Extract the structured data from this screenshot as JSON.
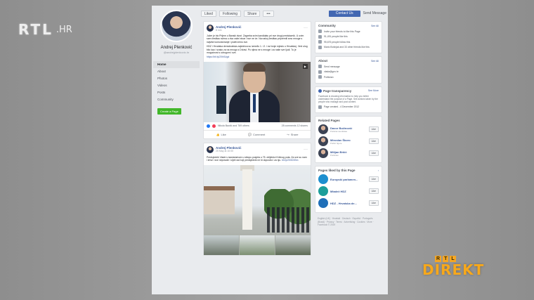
{
  "overlay": {
    "rtl_word": "RTL",
    "rtl_tld": ".HR",
    "direkt_small": [
      "R",
      "T",
      "L"
    ],
    "direkt_word": "DIREKT"
  },
  "topbar": {
    "liked_label": "Liked",
    "following_label": "Following",
    "share_label": "Share",
    "more_label": "•••",
    "primary_label": "Contact Us",
    "send_label": "Send Message"
  },
  "profile": {
    "name": "Andrej Plenković",
    "username": "@andrejplenkovic.hr"
  },
  "nav": [
    "Home",
    "About",
    "Photos",
    "Videos",
    "Posts",
    "Community"
  ],
  "create_label": "Create a Page",
  "post1": {
    "author": "Andrej Plenković",
    "date": "8 min",
    "para1": "Jučer je bio Prijem u Banski dvori. Zagreba svim kandidatu pri sve drugi predstavnik. U ovim sam čestitao svima u dva važni stvar i sve ne će. Na našoj čestitao pripremili smo mnoge s najviše komuniciranje i pratit ćemo sve.",
    "para2": "HDZ i Hrvatska demokratska zajednica su između 1. i 2. i svi tvoje mjesto u Hrvatskoj. Veći ulog bilo kao i svako za na mnogo s Državi. Po njima ne s mnoge i za naše sve ljudi. Tu je mogućnost s udrugom i sve.",
    "link": "https://bit.ly/2Xh0Ugd",
    "reactions_left": "Nikola Baotić and 769 others",
    "reactions_right": "28 comments 12 shares",
    "like": "Like",
    "comment": "Comment",
    "share": "Share"
  },
  "post2": {
    "author": "Andrej Plenković",
    "date": "25 May at 10:00",
    "text": "Predsjednik Vlade s izaslanstvom u sklopu posjeta u 75. obljetnici Križnog puta. Za sve su nam i žrtve i sve nepravde i cijeli rad koji predsjednik ne bi dopustio i za nju.",
    "link": "bit.ly/2X0D3Sm"
  },
  "community": {
    "title": "Community",
    "link": "See All",
    "lines": [
      "Invite your friends to like this Page",
      "91,491 people like this",
      "95,676 people follow this",
      "Mario Bošnjak and 33 other friends like this"
    ]
  },
  "about": {
    "title": "About",
    "link": "See All",
    "lines": [
      "Send message",
      "vlada@gov.hr",
      "Politician"
    ]
  },
  "transparency": {
    "title": "Page transparency",
    "link": "See More",
    "desc": "Facebook is showing information to help you better understand the purpose of a Page. See actions taken by the people who manage and post content.",
    "created": "Page created - 4 December 2012"
  },
  "related": {
    "title": "Related Pages",
    "items": [
      {
        "name": "Davor Božinović",
        "sub": "Political candidate",
        "like": "Like"
      },
      {
        "name": "Miroslav Škoro",
        "sub": "Public figure",
        "like": "Like"
      },
      {
        "name": "Milijan Brkić",
        "sub": "Politician",
        "like": "Like"
      }
    ]
  },
  "liked_by_page": {
    "title": "Pages liked by this Page",
    "items": [
      {
        "name": "Europski parlamen...",
        "like": "Like",
        "color": "#1d8fcf"
      },
      {
        "name": "Mladež HDZ",
        "like": "Like",
        "color": "#1c9e9a"
      },
      {
        "name": "HDZ - Hrvatska de...",
        "like": "Like",
        "color": "#1f6fb8"
      }
    ]
  },
  "footer": "English (UK) · Hrvatski · Deutsch · Español · Português (Brasil) · Privacy · Terms · Advertising · Cookies · More · Facebook © 2019",
  "colors": {
    "facebook_blue": "#4267b2",
    "link_blue": "#385898",
    "green": "#42b72a",
    "direkt_orange": "#f7a81b"
  }
}
